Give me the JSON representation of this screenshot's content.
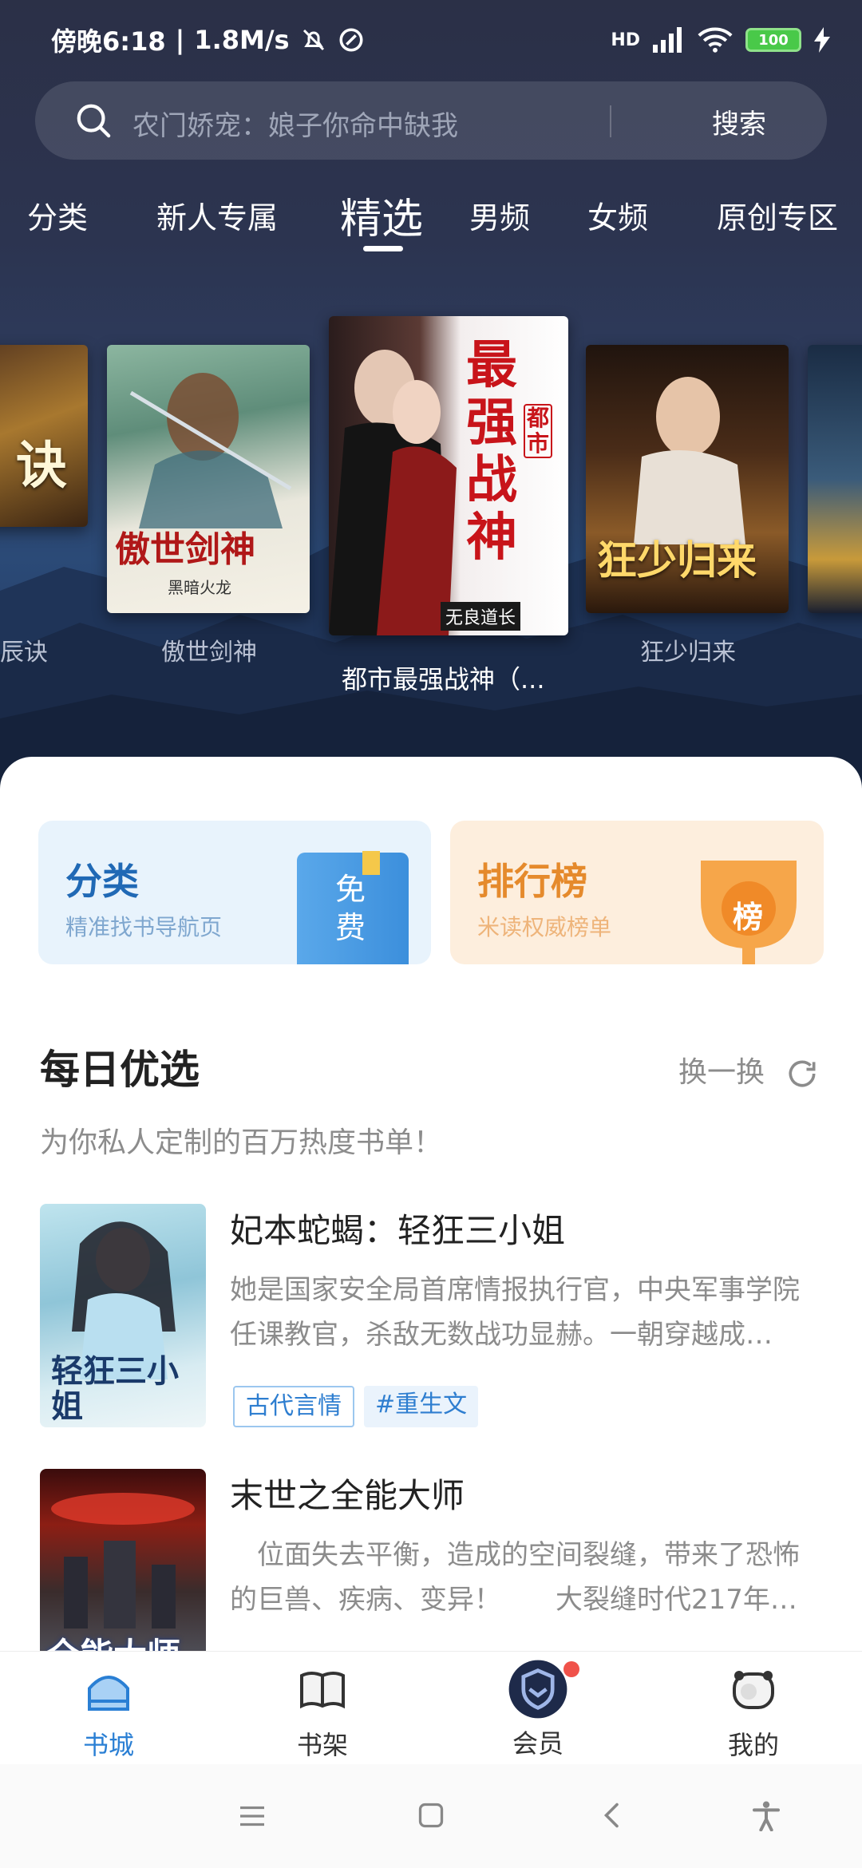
{
  "status_bar": {
    "time": "傍晚6:18",
    "speed": "1.8M/s",
    "network": "HD",
    "battery": "100"
  },
  "search": {
    "placeholder": "农门娇宠：娘子你命中缺我",
    "button": "搜索"
  },
  "tabs": [
    "分类",
    "新人专属",
    "精选",
    "男频",
    "女频",
    "原创专区"
  ],
  "active_tab": "精选",
  "carousel": {
    "items": [
      {
        "caption": "辰诀",
        "cover_text": "诀"
      },
      {
        "caption": "傲世剑神",
        "cover_text": "傲世剑神",
        "author": "黑暗火龙"
      },
      {
        "caption": "都市最强战神（...",
        "cover_text": "最强战神",
        "cover_tag": "都市",
        "author": "无良道长"
      },
      {
        "caption": "狂少归来",
        "cover_text": "狂少归来"
      },
      {
        "caption": "",
        "cover_text": ""
      }
    ]
  },
  "feature_cards": {
    "category": {
      "title": "分类",
      "subtitle": "精准找书导航页",
      "badge": "免费"
    },
    "ranking": {
      "title": "排行榜",
      "subtitle": "米读权威榜单",
      "badge": "榜"
    }
  },
  "daily": {
    "title": "每日优选",
    "swap": "换一换",
    "subtitle": "为你私人定制的百万热度书单！"
  },
  "books": [
    {
      "title": "妃本蛇蝎：轻狂三小姐",
      "desc": "她是国家安全局首席情报执行官，中央军事学院任课教官，杀敌无数战功显赫。一朝穿越成…",
      "tags": [
        "古代言情",
        "#重生文"
      ],
      "cover_text": "轻狂三小姐"
    },
    {
      "title": "末世之全能大师",
      "desc": "　位面失去平衡，造成的空间裂缝，带来了恐怖的巨兽、疾病、变异！　　大裂缝时代217年…",
      "tags": [],
      "cover_text": "全能大师"
    }
  ],
  "bottom_nav": [
    "书城",
    "书架",
    "会员",
    "我的"
  ],
  "colors": {
    "accent": "#2a7fd4",
    "ranking": "#e58a2c",
    "hero_bg": "#2c3450"
  }
}
